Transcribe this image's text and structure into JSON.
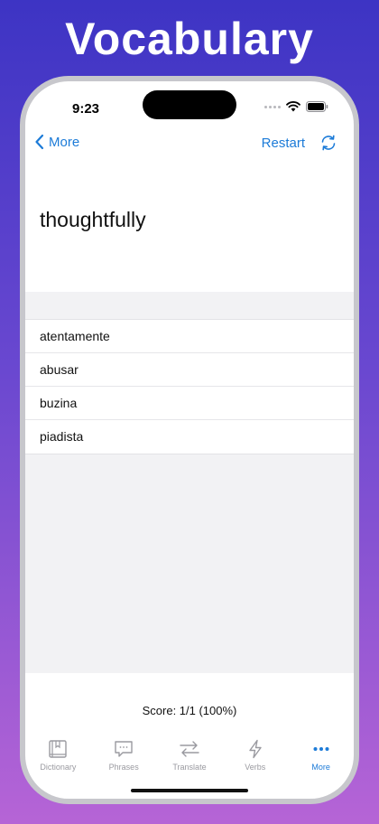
{
  "promo": {
    "headline": "Vocabulary"
  },
  "status_bar": {
    "time": "9:23"
  },
  "nav": {
    "back_label": "More",
    "restart_label": "Restart"
  },
  "quiz": {
    "word": "thoughtfully",
    "answers": [
      "atentamente",
      "abusar",
      "buzina",
      "piadista"
    ],
    "score": "Score: 1/1 (100%)"
  },
  "tabs": [
    {
      "label": "Dictionary",
      "icon": "book-icon",
      "active": false
    },
    {
      "label": "Phrases",
      "icon": "speech-bubble-icon",
      "active": false
    },
    {
      "label": "Translate",
      "icon": "swap-arrows-icon",
      "active": false
    },
    {
      "label": "Verbs",
      "icon": "lightning-icon",
      "active": false
    },
    {
      "label": "More",
      "icon": "ellipsis-icon",
      "active": true
    }
  ],
  "colors": {
    "accent": "#1c7bd8",
    "inactive": "#9a9aa0",
    "background_top": "#3d34c4",
    "background_bottom": "#b664d6"
  }
}
